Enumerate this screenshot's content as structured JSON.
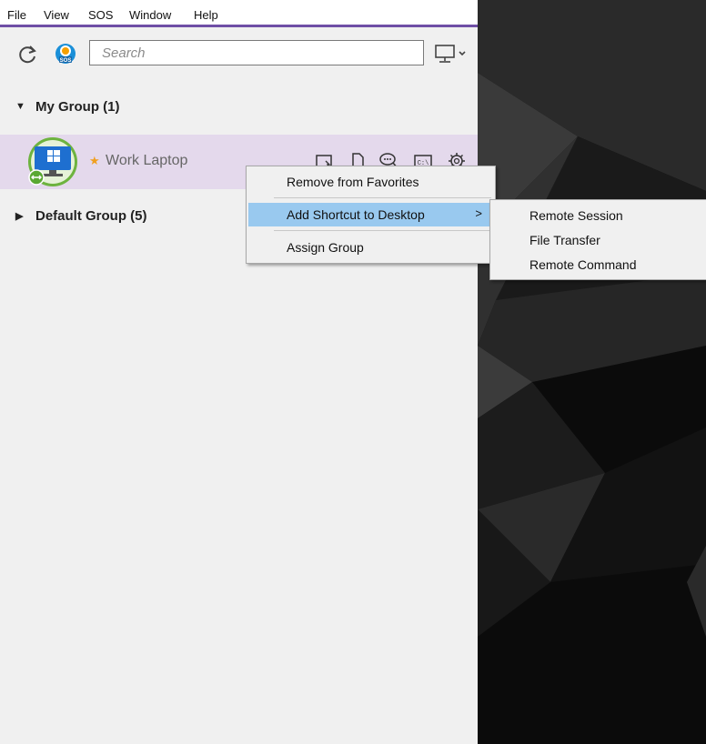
{
  "menubar": {
    "items": [
      "File",
      "View",
      "SOS",
      "Window",
      "Help"
    ]
  },
  "toolbar": {
    "search_placeholder": "Search",
    "refresh_icon": "refresh-icon",
    "sos_icon": "sos-icon",
    "device_dropdown_icon": "monitor-dropdown-icon"
  },
  "groups": {
    "my_group": {
      "label": "My Group (1)",
      "expanded": true
    },
    "default_group": {
      "label": "Default Group (5)",
      "expanded": false
    }
  },
  "device": {
    "name": "Work Laptop",
    "favorite": true,
    "highlight_color": "#e4d9ec",
    "actions": [
      "remote-session-icon",
      "file-transfer-icon",
      "chat-icon",
      "remote-command-icon",
      "settings-icon"
    ]
  },
  "context_menu": {
    "items": [
      {
        "label": "Remove from Favorites"
      },
      {
        "label": "Add Shortcut to Desktop",
        "has_submenu": true,
        "arrow": ">",
        "highlighted": true
      },
      {
        "label": "Assign Group"
      }
    ],
    "highlight_color": "#99c9ef"
  },
  "submenu": {
    "items": [
      "Remote Session",
      "File Transfer",
      "Remote Command"
    ]
  },
  "theme": {
    "accent": "#6f4fa6",
    "panel_bg": "#f0f0f0"
  }
}
